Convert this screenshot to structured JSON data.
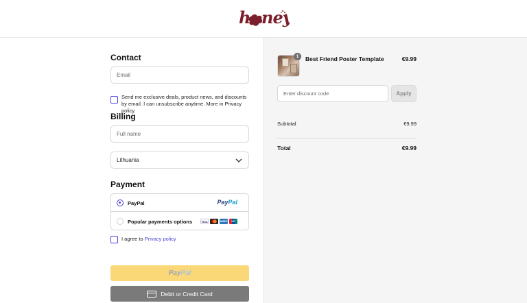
{
  "brand": {
    "logo_text": "honey"
  },
  "contact": {
    "heading": "Contact",
    "email_placeholder": "Email",
    "marketing_optin": "Send me exclusive deals, product news, and discounts by email. I can unsubscribe anytime. More in Privacy policy."
  },
  "billing": {
    "heading": "Billing",
    "fullname_placeholder": "Full name",
    "country": "Lithuania"
  },
  "payment": {
    "heading": "Payment",
    "options": [
      {
        "label": "PayPal",
        "brand_a": "Pay",
        "brand_b": "Pal",
        "selected": true
      },
      {
        "label": "Popular payments options",
        "cards": [
          "VISA",
          "MC",
          "AMEX",
          "UP"
        ],
        "selected": false
      }
    ],
    "agree_prefix": "I agree to ",
    "agree_link": "Privacy policy",
    "paypal_button_a": "Pay",
    "paypal_button_b": "Pal",
    "card_button": "Debit or Credit Card"
  },
  "order": {
    "item": {
      "name": "Best Friend Poster Template",
      "price": "€9.99",
      "quantity": "1"
    },
    "discount_placeholder": "Enter discount code",
    "apply_label": "Apply",
    "subtotal_label": "Subtotal",
    "subtotal_value": "€9.99",
    "total_label": "Total",
    "total_value": "€9.99"
  },
  "colors": {
    "accent": "#4b3fd6",
    "logo": "#7a1f2b",
    "paypal_button": "#fbd877",
    "card_button": "#7a7a7a"
  }
}
